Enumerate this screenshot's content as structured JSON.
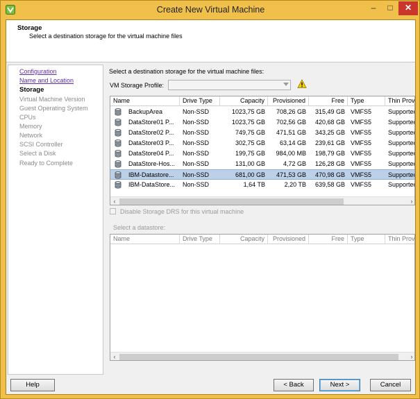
{
  "window": {
    "title": "Create New Virtual Machine",
    "minimize_glyph": "–",
    "maximize_glyph": "□",
    "close_glyph": "✕"
  },
  "header": {
    "title": "Storage",
    "subtitle": "Select a destination storage for the virtual machine files"
  },
  "steps": [
    {
      "label": "Configuration",
      "state": "link"
    },
    {
      "label": "Name and Location",
      "state": "link"
    },
    {
      "label": "Storage",
      "state": "current"
    },
    {
      "label": "Virtual Machine Version",
      "state": "disabled"
    },
    {
      "label": "Guest Operating System",
      "state": "disabled"
    },
    {
      "label": "CPUs",
      "state": "disabled"
    },
    {
      "label": "Memory",
      "state": "disabled"
    },
    {
      "label": "Network",
      "state": "disabled"
    },
    {
      "label": "SCSI Controller",
      "state": "disabled"
    },
    {
      "label": "Select a Disk",
      "state": "disabled"
    },
    {
      "label": "Ready to Complete",
      "state": "disabled"
    }
  ],
  "main": {
    "heading": "Select a destination storage for the virtual machine files:",
    "profile_label": "VM Storage Profile:",
    "profile_value": "",
    "disable_drs_label": "Disable Storage DRS for this virtual machine",
    "disable_drs_checked": false,
    "select_datastore_label": "Select a datastore:"
  },
  "columns": [
    "Name",
    "Drive Type",
    "Capacity",
    "Provisioned",
    "Free",
    "Type",
    "Thin Prov"
  ],
  "datastores": [
    {
      "name": "BackupArea",
      "drive": "Non-SSD",
      "capacity": "1023,75 GB",
      "provisioned": "708,26 GB",
      "free": "315,49 GB",
      "type": "VMFS5",
      "thin": "Supported"
    },
    {
      "name": "DataStore01 P...",
      "drive": "Non-SSD",
      "capacity": "1023,75 GB",
      "provisioned": "702,56 GB",
      "free": "420,68 GB",
      "type": "VMFS5",
      "thin": "Supported"
    },
    {
      "name": "DataStore02 P...",
      "drive": "Non-SSD",
      "capacity": "749,75 GB",
      "provisioned": "471,51 GB",
      "free": "343,25 GB",
      "type": "VMFS5",
      "thin": "Supported"
    },
    {
      "name": "DataStore03 P...",
      "drive": "Non-SSD",
      "capacity": "302,75 GB",
      "provisioned": "63,14 GB",
      "free": "239,61 GB",
      "type": "VMFS5",
      "thin": "Supported"
    },
    {
      "name": "DataStore04 P...",
      "drive": "Non-SSD",
      "capacity": "199,75 GB",
      "provisioned": "984,00 MB",
      "free": "198,79 GB",
      "type": "VMFS5",
      "thin": "Supported"
    },
    {
      "name": "DataStore-Hos...",
      "drive": "Non-SSD",
      "capacity": "131,00 GB",
      "provisioned": "4,72 GB",
      "free": "126,28 GB",
      "type": "VMFS5",
      "thin": "Supported"
    },
    {
      "name": "IBM-Datastore...",
      "drive": "Non-SSD",
      "capacity": "681,00 GB",
      "provisioned": "471,53 GB",
      "free": "470,98 GB",
      "type": "VMFS5",
      "thin": "Supported",
      "selected": true
    },
    {
      "name": "IBM-DataStore...",
      "drive": "Non-SSD",
      "capacity": "1,64 TB",
      "provisioned": "2,20 TB",
      "free": "639,58 GB",
      "type": "VMFS5",
      "thin": "Supported"
    }
  ],
  "buttons": {
    "help": "Help",
    "back": "< Back",
    "next": "Next >",
    "cancel": "Cancel"
  },
  "icons": {
    "app": "vsphere-client-icon",
    "datastore": "datastore-icon",
    "warning": "warning-icon"
  },
  "colors": {
    "frame": "#f0c04a",
    "selection": "#bcd0e8",
    "link": "#5c2da8",
    "close": "#c9372c"
  }
}
